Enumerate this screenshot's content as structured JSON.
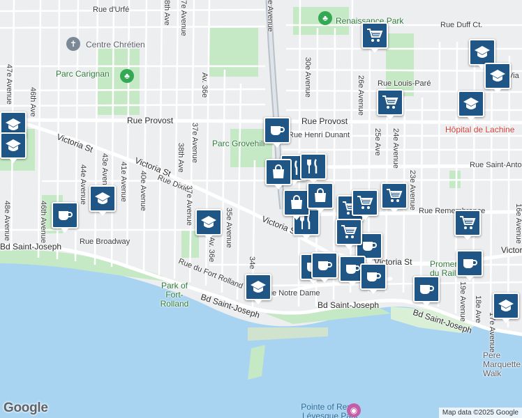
{
  "map": {
    "attribution": "Map data ©2025 Google",
    "logo": "Google",
    "water_color": "#a8d4f2",
    "park_color": "#c5e8c5",
    "marker_color": "#1f5685"
  },
  "labels": {
    "parks": [
      "Renaissance Park",
      "Parc Carignan",
      "Parc Grovehill",
      "Park of Fort-Rolland",
      "Promenade du Rail"
    ],
    "pois": [
      "Centre Chrétien",
      "Hôpital de Lachine",
      "Pointe of René-Lévesque Park",
      "Pere Marquette Walk"
    ],
    "main_roads": [
      "Rue Provost",
      "Victoria St",
      "Bd Saint-Joseph",
      "Rue Notre Dame",
      "Rue Saint-Antoine",
      "Rue Remembrance",
      "Rue Henri Dunant",
      "Rue Louis-Paré",
      "Rue Duff Ct.",
      "Rue d'Urfé",
      "Rue Dixie",
      "Rue Broadway",
      "Rue du Fort Rolland",
      "Via"
    ],
    "avenues": [
      "47e Avenue",
      "46th Ave",
      "48e Avenue",
      "46th Avenue",
      "44e Avenue",
      "43e Avenue",
      "41e Avenue",
      "40e Avenue",
      "38th Ave",
      "37e Avenue",
      "Av. 36e",
      "35e Avenue",
      "34e",
      "30e Avenue",
      "26e Avenue",
      "25e Ave",
      "24e Avenue",
      "23e Avenue",
      "19e Avenue",
      "18e Ave",
      "17e Avenue",
      "16e Avenue",
      "7e Avenue",
      "8th Ave",
      "e Avenue"
    ]
  },
  "markers": [
    {
      "type": "cafe-icon"
    },
    {
      "type": "cafe-icon"
    },
    {
      "type": "cafe-icon"
    },
    {
      "type": "cafe-icon"
    },
    {
      "type": "cafe-icon"
    },
    {
      "type": "cafe-icon"
    },
    {
      "type": "cafe-icon"
    },
    {
      "type": "cafe-icon"
    },
    {
      "type": "cafe-icon"
    },
    {
      "type": "shopping-cart-icon"
    },
    {
      "type": "shopping-cart-icon"
    },
    {
      "type": "shopping-cart-icon"
    },
    {
      "type": "shopping-cart-icon"
    },
    {
      "type": "shopping-cart-icon"
    },
    {
      "type": "shopping-cart-icon"
    },
    {
      "type": "shopping-cart-icon"
    },
    {
      "type": "school-icon"
    },
    {
      "type": "school-icon"
    },
    {
      "type": "school-icon"
    },
    {
      "type": "school-icon"
    },
    {
      "type": "school-icon"
    },
    {
      "type": "school-icon"
    },
    {
      "type": "school-icon"
    },
    {
      "type": "school-icon"
    },
    {
      "type": "school-icon"
    },
    {
      "type": "restaurant-icon"
    },
    {
      "type": "restaurant-icon"
    },
    {
      "type": "restaurant-icon"
    },
    {
      "type": "shopping-bag-icon"
    },
    {
      "type": "shopping-bag-icon"
    },
    {
      "type": "shopping-bag-icon"
    }
  ]
}
